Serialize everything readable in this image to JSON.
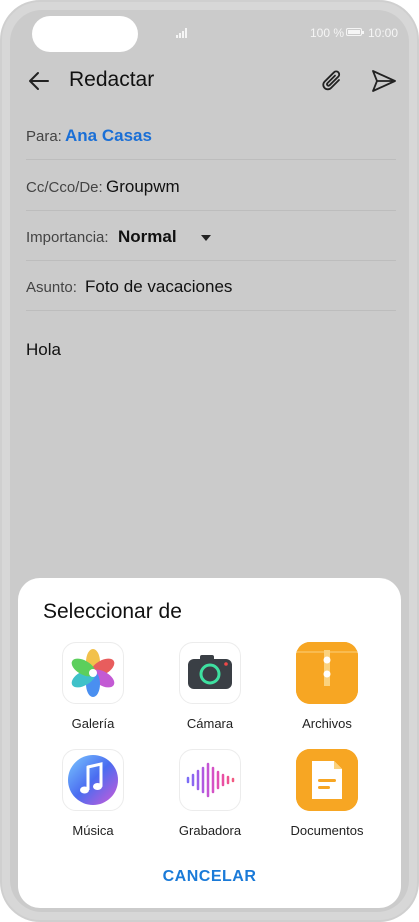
{
  "status_bar": {
    "battery_percent": "100 %",
    "time": "10:00"
  },
  "header": {
    "title": "Redactar"
  },
  "form": {
    "to_label": "Para:",
    "to_value": "Ana Casas",
    "cc_label": "Cc/Cco/De:",
    "cc_value": "Groupwm",
    "importance_label": "Importancia:",
    "importance_value": "Normal",
    "subject_label": "Asunto:",
    "subject_value": "Foto de vacaciones",
    "body": "Hola"
  },
  "sheet": {
    "title": "Seleccionar de",
    "options": [
      {
        "label": "Galería",
        "icon": "gallery-icon"
      },
      {
        "label": "Cámara",
        "icon": "camera-icon"
      },
      {
        "label": "Archivos",
        "icon": "files-icon"
      },
      {
        "label": "Música",
        "icon": "music-icon"
      },
      {
        "label": "Grabadora",
        "icon": "recorder-icon"
      },
      {
        "label": "Documentos",
        "icon": "documents-icon"
      }
    ],
    "cancel_label": "CANCELAR"
  },
  "colors": {
    "accent": "#1a7ad8",
    "link": "#1a6fd6",
    "files_orange": "#f7a623"
  }
}
